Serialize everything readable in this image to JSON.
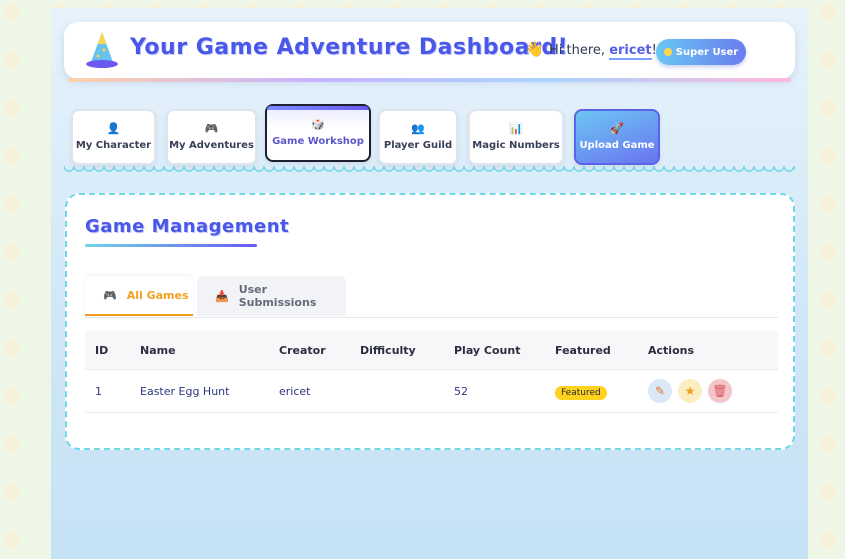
{
  "header": {
    "title": "Your Game Adventure Dashboard!",
    "greeting_prefix": "Hi there, ",
    "username": "ericet",
    "greeting_suffix": "!",
    "role_badge": "Super User"
  },
  "nav": {
    "items": [
      {
        "label": "My Character",
        "icon": "person-icon",
        "glyph": "👤"
      },
      {
        "label": "My Adventures",
        "icon": "gamepad-icon",
        "glyph": "🎮"
      },
      {
        "label": "Game Workshop",
        "icon": "dice-icon",
        "glyph": "🎲",
        "active": true
      },
      {
        "label": "Player Guild",
        "icon": "group-icon",
        "glyph": "👥"
      },
      {
        "label": "Magic Numbers",
        "icon": "bar-chart-icon",
        "glyph": "📊"
      },
      {
        "label": "Upload Game",
        "icon": "rocket-icon",
        "glyph": "🚀"
      }
    ]
  },
  "panel": {
    "title": "Game Management",
    "tabs": [
      {
        "label": "All Games",
        "icon": "gamepad-icon",
        "glyph": "🎮",
        "active": true
      },
      {
        "label": "User Submissions",
        "icon": "inbox-icon",
        "glyph": "📥"
      }
    ]
  },
  "table": {
    "headers": [
      "ID",
      "Name",
      "Creator",
      "Difficulty",
      "Play Count",
      "Featured",
      "Actions"
    ],
    "rows": [
      {
        "id": "1",
        "name": "Easter Egg Hunt",
        "creator": "ericet",
        "difficulty": "",
        "play_count": "52",
        "featured": "Featured"
      }
    ]
  },
  "colors": {
    "accent": "#4a58e8",
    "featured": "#ffd21f",
    "active_tab": "#f0a020",
    "dashed_border": "#6fd8e8"
  }
}
